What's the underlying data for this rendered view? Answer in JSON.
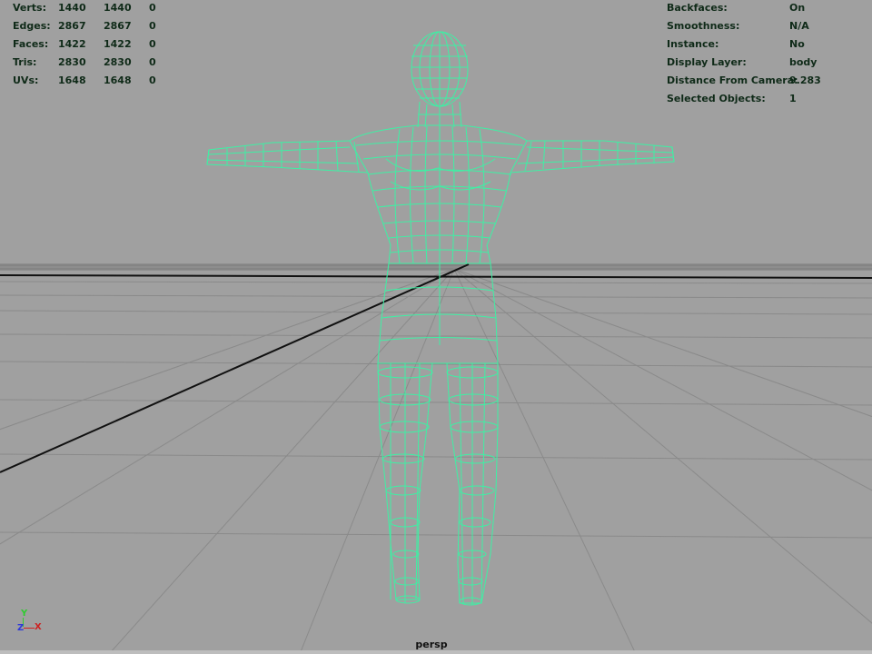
{
  "viewport": {
    "camera": "persp",
    "background_color": "#a0a0a0",
    "wireframe_color": "#3ef0a4"
  },
  "heads_up_left": {
    "rows": [
      {
        "label": "Verts:",
        "total": "1440",
        "selected_object": "1440",
        "selected": "0"
      },
      {
        "label": "Edges:",
        "total": "2867",
        "selected_object": "2867",
        "selected": "0"
      },
      {
        "label": "Faces:",
        "total": "1422",
        "selected_object": "1422",
        "selected": "0"
      },
      {
        "label": "Tris:",
        "total": "2830",
        "selected_object": "2830",
        "selected": "0"
      },
      {
        "label": "UVs:",
        "total": "1648",
        "selected_object": "1648",
        "selected": "0"
      }
    ]
  },
  "heads_up_right": {
    "rows": [
      {
        "label": "Backfaces:",
        "value": "On"
      },
      {
        "label": "Smoothness:",
        "value": "N/A"
      },
      {
        "label": "Instance:",
        "value": "No"
      },
      {
        "label": "Display Layer:",
        "value": "body"
      },
      {
        "label": "Distance From Camera:",
        "value": "9.283"
      },
      {
        "label": "Selected Objects:",
        "value": "1"
      }
    ]
  },
  "axis_indicator": {
    "y": "Y",
    "z": "Z",
    "x": "X",
    "colors": {
      "x": "#cc2222",
      "y": "#2ecc2e",
      "z": "#2f3ad9"
    }
  }
}
